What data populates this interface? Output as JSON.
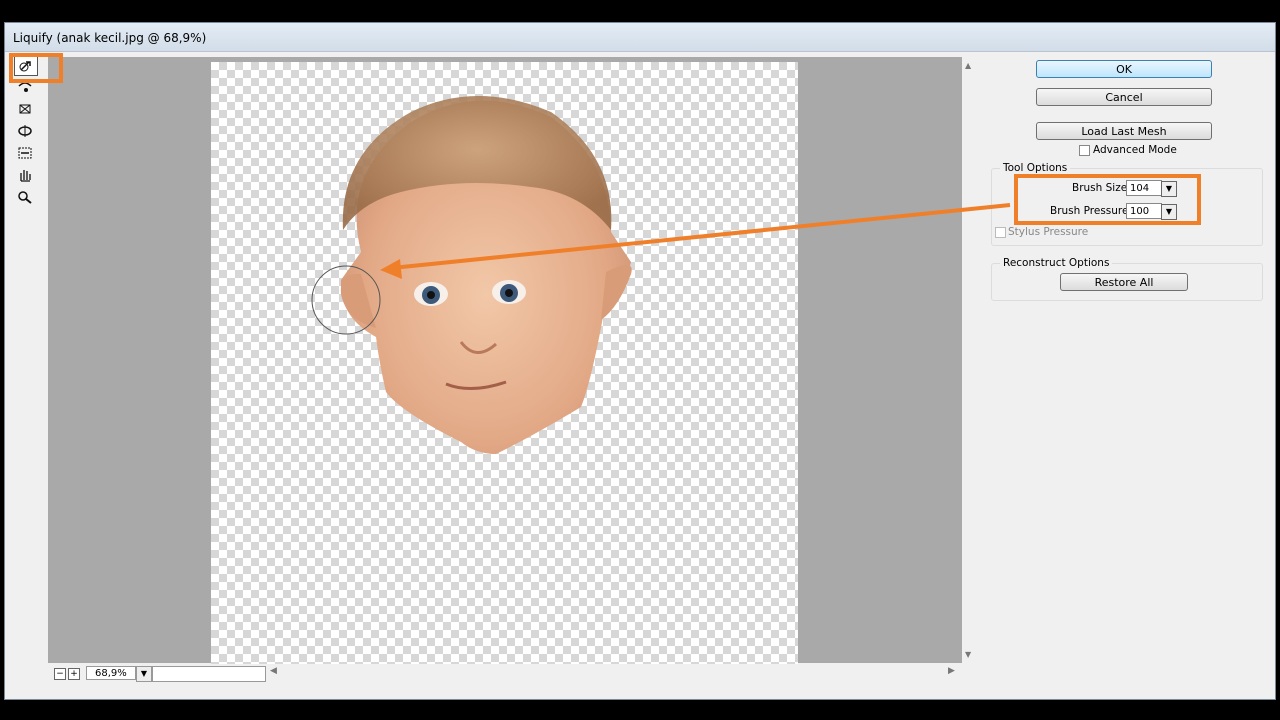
{
  "window": {
    "title": "Liquify (anak kecil.jpg @ 68,9%)"
  },
  "buttons": {
    "ok": "OK",
    "cancel": "Cancel",
    "load_last_mesh": "Load Last Mesh",
    "restore_all": "Restore All"
  },
  "advanced_mode": {
    "label": "Advanced Mode",
    "checked": false
  },
  "tool_options": {
    "title": "Tool Options",
    "brush_size_label": "Brush Size:",
    "brush_size": "104",
    "brush_pressure_label": "Brush Pressure:",
    "brush_pressure": "100",
    "stylus_pressure_label": "Stylus Pressure"
  },
  "reconstruct_options": {
    "title": "Reconstruct Options"
  },
  "zoom": {
    "value": "68,9%",
    "minus": "−",
    "plus": "+"
  },
  "tools": [
    "forward-warp-icon",
    "reconstruct-icon",
    "pucker-icon",
    "bloat-icon",
    "push-left-icon",
    "hand-icon",
    "zoom-icon"
  ],
  "colors": {
    "highlight": "#f07f2a",
    "ok_border": "#3c7fb1"
  }
}
